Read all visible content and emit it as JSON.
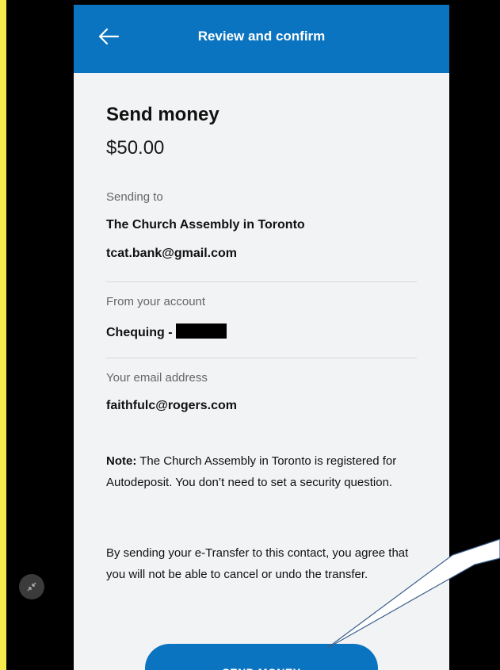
{
  "header": {
    "title": "Review and confirm"
  },
  "summary": {
    "title": "Send money",
    "amount": "$50.00"
  },
  "recipient": {
    "label": "Sending to",
    "name": "The Church Assembly in Toronto",
    "email": "tcat.bank@gmail.com"
  },
  "account": {
    "label": "From your account",
    "value": "Chequing -"
  },
  "sender": {
    "label": "Your email address",
    "email": "faithfulc@rogers.com"
  },
  "note": {
    "bold": "Note:",
    "text": " The Church Assembly in Toronto is registered for Autodeposit. You don’t need to set a security question."
  },
  "disclaimer": "By sending your e-Transfer to this contact, you agree that you will not be able to cancel or undo the transfer.",
  "action": {
    "send_label": "SEND MONEY"
  },
  "icons": {
    "back": "arrow-left-icon",
    "minimize": "minimize-arrows-icon"
  },
  "colors": {
    "brand": "#0b74c0",
    "background": "#f2f3f5",
    "redaction": "#000000"
  }
}
